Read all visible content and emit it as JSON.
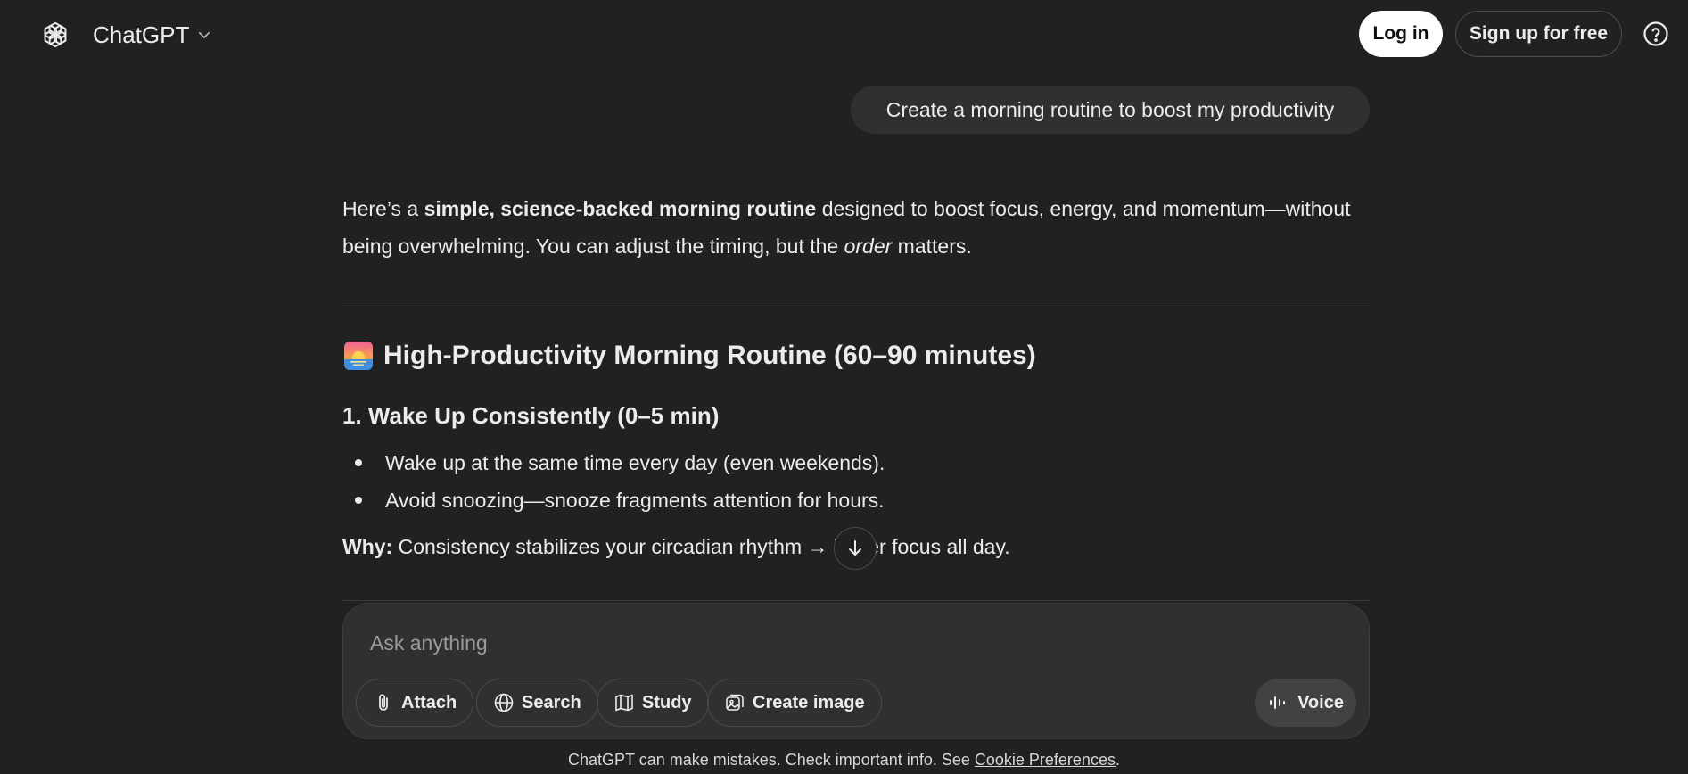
{
  "header": {
    "model_name": "ChatGPT",
    "login_label": "Log in",
    "signup_label": "Sign up for free",
    "help_icon": "question-circle-icon"
  },
  "conversation": {
    "user_message": "Create a morning routine to boost my productivity",
    "intro": {
      "part1": "Here’s a ",
      "bold1": "simple, science-backed morning routine",
      "part2": " designed to boost focus, energy, and momentum—without being overwhelming. You can adjust the timing, but the ",
      "italic1": "order",
      "part3": " matters."
    },
    "heading_emoji": "sunrise-emoji",
    "heading": "High-Productivity Morning Routine (60–90 minutes)",
    "section1": {
      "title": "1. Wake Up Consistently (0–5 min)",
      "bullets": [
        "Wake up at the same time every day (even weekends).",
        "Avoid snoozing—snooze fragments attention for hours."
      ],
      "why_label": "Why:",
      "why_text": " Consistency stabilizes your circadian rhythm → better focus all day."
    }
  },
  "composer": {
    "placeholder": "Ask anything",
    "tools": {
      "attach": "Attach",
      "search": "Search",
      "study": "Study",
      "create_image": "Create image"
    },
    "voice": "Voice"
  },
  "footer": {
    "note": "ChatGPT can make mistakes. Check important info. See ",
    "link": "Cookie Preferences",
    "end": "."
  },
  "colors": {
    "background": "#212121",
    "bubble": "#303030",
    "text": "#ececec",
    "login_bg": "#ffffff"
  }
}
